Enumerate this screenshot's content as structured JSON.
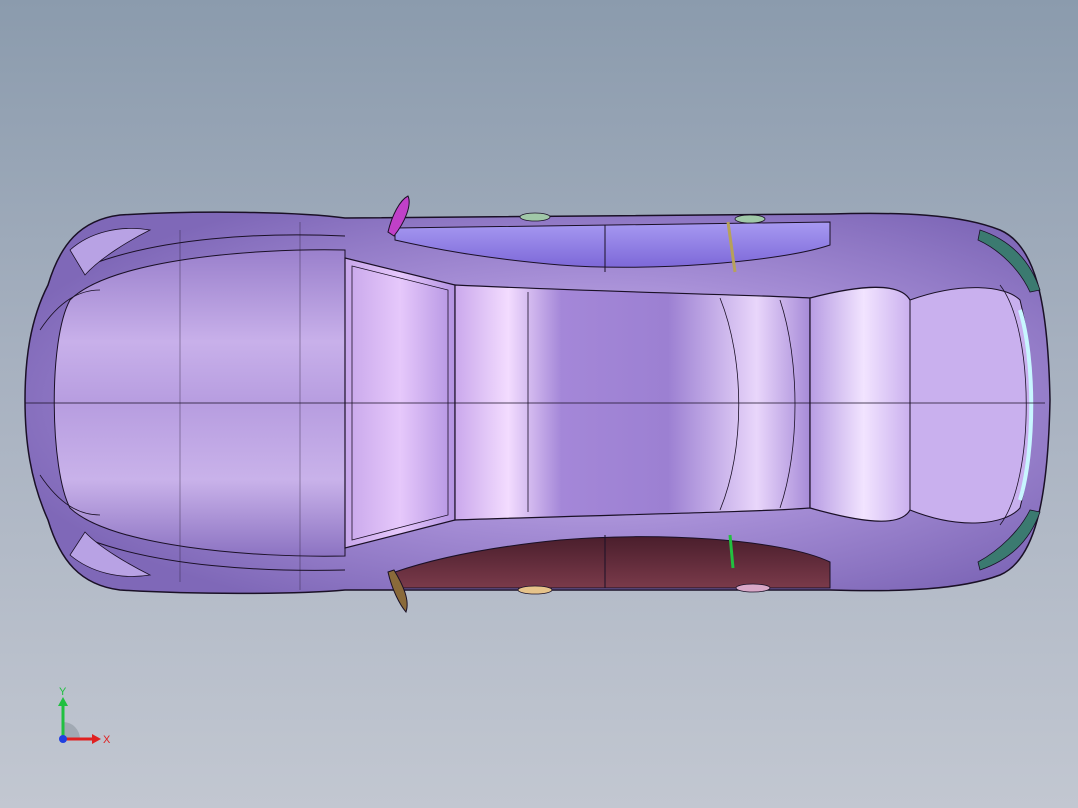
{
  "viewport": {
    "background_top": "#8b9bad",
    "background_bottom": "#c2c7d1"
  },
  "model": {
    "body_color": "#a58fd6",
    "edge_color": "#1a1026",
    "glass_dark": "#6b2a3a",
    "glass_light": "#8a78e0",
    "highlight": "#f4e6ff"
  },
  "triad": {
    "x_label": "X",
    "y_label": "Y",
    "x_color": "#e02020",
    "y_color": "#20c040",
    "z_color": "#2040e0"
  }
}
